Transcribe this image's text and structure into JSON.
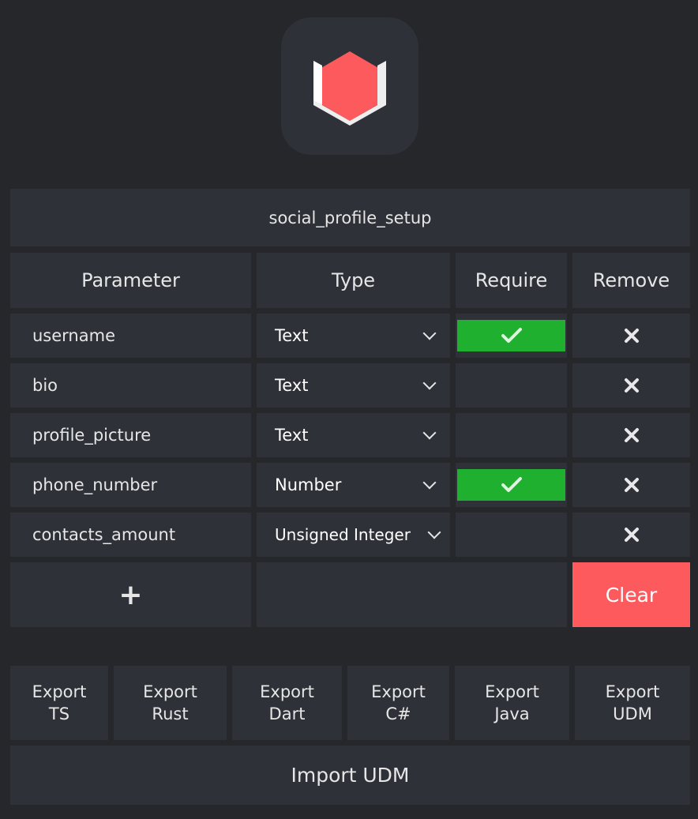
{
  "app": {
    "title": "social_profile_setup",
    "logo_icon": "hexagon-logo-icon",
    "brand_color": "#fc5a5d",
    "accent_green": "#1fb02f"
  },
  "table": {
    "headers": {
      "parameter": "Parameter",
      "type": "Type",
      "require": "Require",
      "remove": "Remove"
    },
    "rows": [
      {
        "name": "username",
        "type": "Text",
        "required": true
      },
      {
        "name": "bio",
        "type": "Text",
        "required": false
      },
      {
        "name": "profile_picture",
        "type": "Text",
        "required": false
      },
      {
        "name": "phone_number",
        "type": "Number",
        "required": true
      },
      {
        "name": "contacts_amount",
        "type": "Unsigned Integer",
        "required": false
      }
    ],
    "remove_icon": "close-icon",
    "require_icon": "check-icon",
    "dropdown_icon": "chevron-down-icon"
  },
  "actions": {
    "add_label": "+",
    "clear_label": "Clear"
  },
  "exports": [
    {
      "line1": "Export",
      "line2": "TS"
    },
    {
      "line1": "Export",
      "line2": "Rust"
    },
    {
      "line1": "Export",
      "line2": "Dart"
    },
    {
      "line1": "Export",
      "line2": "C#"
    },
    {
      "line1": "Export",
      "line2": "Java"
    },
    {
      "line1": "Export",
      "line2": "UDM"
    }
  ],
  "import_label": "Import UDM"
}
